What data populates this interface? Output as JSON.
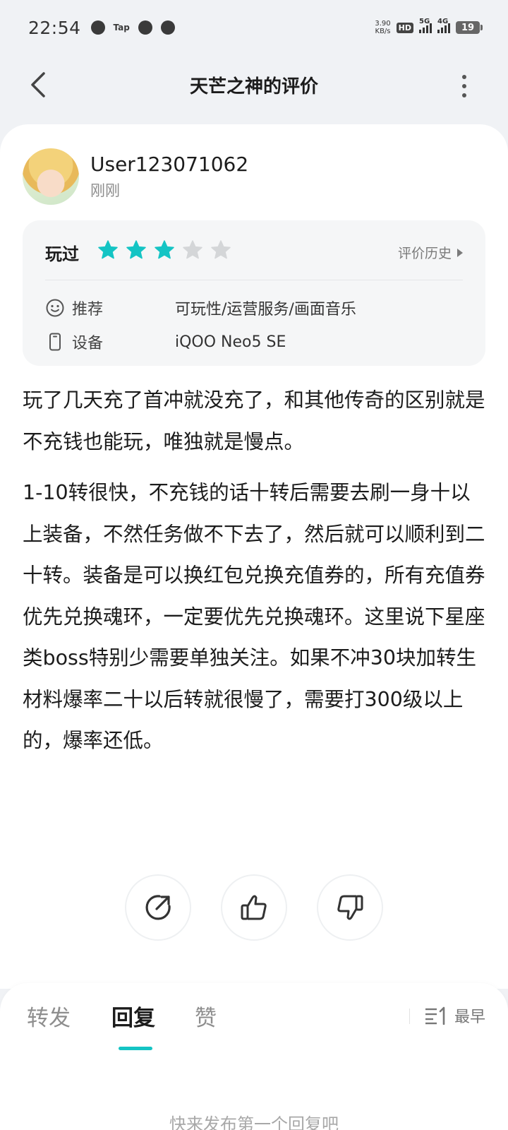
{
  "status_bar": {
    "time": "22:54",
    "notif_tap": "Tap",
    "net_speed_value": "3.90",
    "net_speed_unit": "KB/s",
    "hd_badge": "HD",
    "sim1_label": "5G",
    "sim2_label": "4G",
    "battery": "19"
  },
  "nav": {
    "title": "天芒之神的评价",
    "back_icon": "chevron-left-icon",
    "more_icon": "more-vertical-icon"
  },
  "review": {
    "username": "User123071062",
    "time": "刚刚",
    "played_label": "玩过",
    "rating": 3,
    "rating_max": 5,
    "history_label": "评价历史",
    "recommend_label": "推荐",
    "recommend_value": "可玩性/运营服务/画面音乐",
    "device_label": "设备",
    "device_value": "iQOO Neo5 SE",
    "paragraphs": [
      "玩了几天充了首冲就没充了，和其他传奇的区别就是不充钱也能玩，唯独就是慢点。",
      "1-10转很快，不充钱的话十转后需要去刷一身十以上装备，不然任务做不下去了，然后就可以顺利到二十转。装备是可以换红包兑换充值券的，所有充值券优先兑换魂环，一定要优先兑换魂环。这里说下星座类boss特别少需要单独关注。如果不冲30块加转生材料爆率二十以后转就很慢了，需要打300级以上的，爆率还低。"
    ]
  },
  "replies": {
    "tabs": [
      "转发",
      "回复",
      "赞"
    ],
    "active_tab": "回复",
    "sort_label": "最早",
    "empty_text": "快来发布第一个回复吧"
  },
  "colors": {
    "accent": "#14c4c4",
    "star_filled": "#14c4c4",
    "star_empty": "#d4d6d8"
  }
}
